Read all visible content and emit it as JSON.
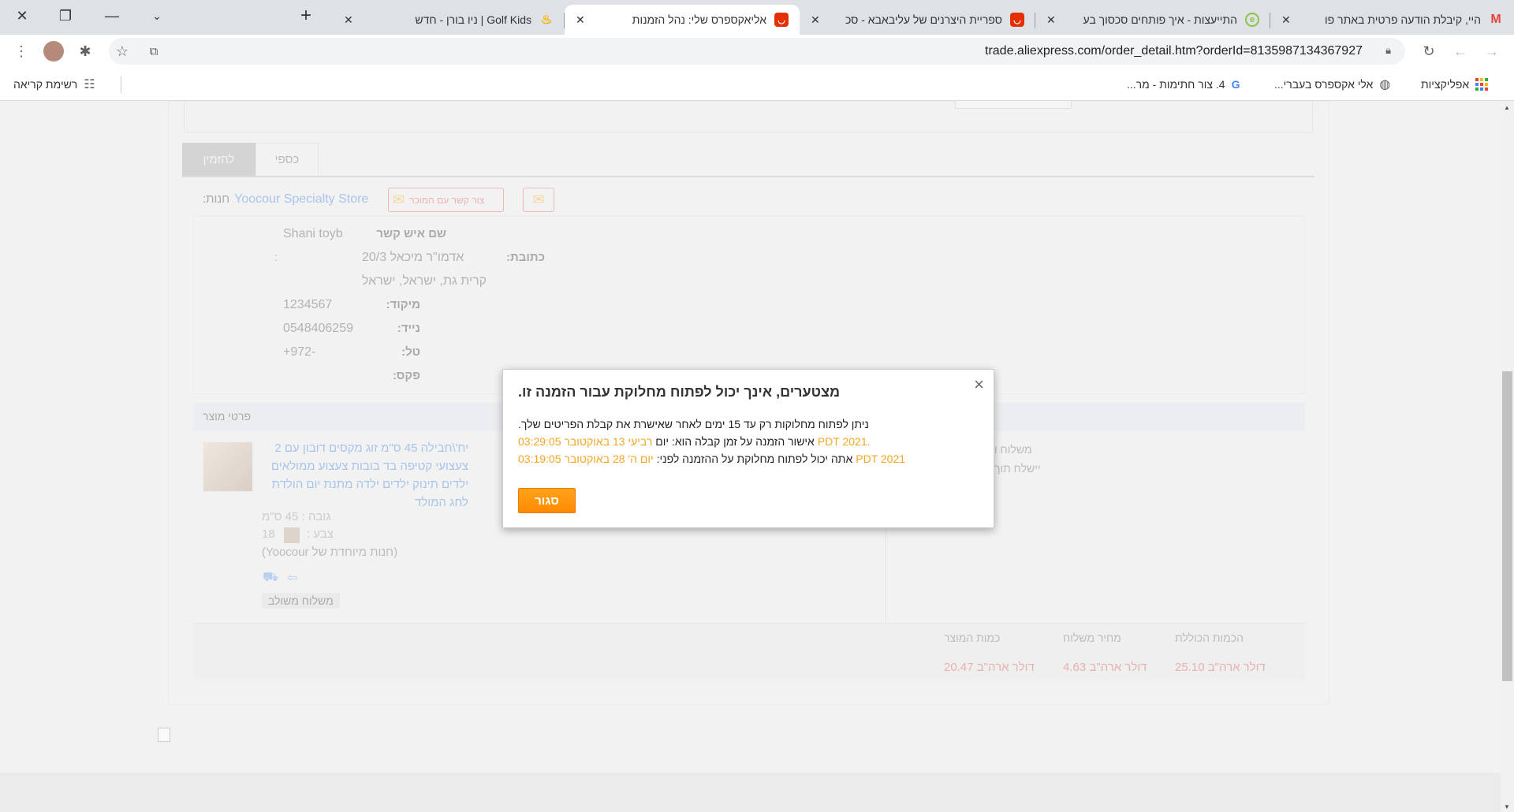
{
  "browser": {
    "window_controls": [
      "close",
      "restore",
      "minimize",
      "tab-search"
    ],
    "tabs": [
      {
        "title": "Golf Kids | ניו בורן - חדש",
        "icon": "golf-kids-icon",
        "active": false,
        "icon_color": "#f5b400"
      },
      {
        "title": "אליאקספרס שלי: נהל הזמנות",
        "icon": "aliexpress-icon",
        "active": true,
        "icon_color": "#e62e04"
      },
      {
        "title": "ספריית היצרנים של עליבאבא - סכ",
        "icon": "aliexpress-icon",
        "active": false,
        "icon_color": "#e62e04"
      },
      {
        "title": "התייעצות - איך פותחים סכסוך בע",
        "icon": "forum-icon",
        "active": false,
        "icon_color": "#8bc34a"
      },
      {
        "title": "היי, קיבלת הודעה פרטית באתר פו",
        "icon": "gmail-icon",
        "active": false,
        "icon_color": "#ea4335"
      }
    ],
    "new_tab": "+",
    "url": "trade.aliexpress.com/order_detail.htm?orderId=8135987134367927",
    "bookmarks": [
      {
        "label": "אפליקציות",
        "icon": "apps-grid-icon"
      },
      {
        "label": "אלי אקספרס בעברי...",
        "icon": "globe-icon"
      },
      {
        "label": "4. צור חתימות - מר...",
        "icon": "google-icon"
      }
    ],
    "reading_list": "רשימת קריאה"
  },
  "page": {
    "tabs": [
      "להזמין",
      "כספי"
    ],
    "store_label": "חנות:",
    "store_name": "Yoocour Specialty Store",
    "contact_seller": "צור קשר עם המוכר",
    "address": {
      "contact_label": "שם איש קשר",
      "contact": "Shani toyb",
      "address_label": "כתובת:",
      "colon": ":",
      "address_line1": "אדמו\"ר מיכאל 20/3",
      "address_line2": "קרית גת, ישראל, ישראל",
      "zip_label": "מיקוד:",
      "zip": "1234567",
      "mobile_label": "נייד:",
      "mobile": "0548406259",
      "phone_label": "טל:",
      "phone": "+972-",
      "fax_label": "פקס:"
    },
    "product_header": "פרטי מוצר",
    "product": {
      "title_lines": [
        "יח'\\חבילה 45 ס\"מ זוג מקסים דובון עם 2",
        "צעצועי קטיפה בד בובות צעצוע ממולאים",
        "ילדים תינוק ילדים ילדה מתנת יום הולדת",
        "לחג המולד"
      ],
      "height": "גובה : 45 ס\"מ",
      "color_label": "צבע :",
      "color_value": "18",
      "store": "(Yoocour חנות מיוחדת של)",
      "shipping_tag": "משלוח משולב",
      "shipping_col_1": "משלוח ו",
      "shipping_col_2": "יישלח תוך"
    },
    "totals": {
      "labels": [
        "כמות המוצר",
        "מחיר משלוח",
        "הכמות הכוללת"
      ],
      "values": [
        "דולר ארה\"ב 20.47",
        "דולר ארה\"ב 4.63",
        "דולר ארה\"ב 25.10"
      ]
    }
  },
  "modal": {
    "title": "מצטערים, אינך יכול לפתוח מחלוקת עבור הזמנה זו.",
    "line1": "ניתן לפתוח מחלוקות רק עד 15 ימים לאחר שאישרת את קבלת הפריטים שלך.",
    "line2_text": "אישור הזמנה על זמן קבלה הוא: יום",
    "line2_date": "רביעי 13 באוקטובר 03:29:05",
    "line2_tz": "PDT 2021.",
    "line3_text": "אתה יכול לפתוח מחלוקת על ההזמנה לפני:",
    "line3_date": "יום ה' 28 באוקטובר 03:19:05",
    "line3_tz": "PDT 2021",
    "close_button": "סגור",
    "close_x": "×",
    "accent": "#f5a623"
  }
}
